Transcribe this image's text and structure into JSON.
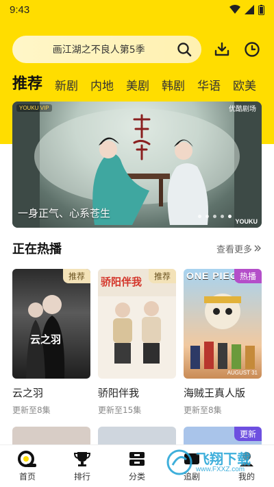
{
  "status": {
    "time": "9:43"
  },
  "search": {
    "query": "画江湖之不良人第5季"
  },
  "tabs": [
    {
      "label": "推荐",
      "active": true
    },
    {
      "label": "新剧"
    },
    {
      "label": "内地"
    },
    {
      "label": "美剧"
    },
    {
      "label": "韩剧"
    },
    {
      "label": "华语"
    },
    {
      "label": "欧美"
    }
  ],
  "banner": {
    "caption": "一身正气、心系苍生",
    "logo_top_left": "YOUKU VIP",
    "logo_top_right": "优酷剧场",
    "logo_bottom_right": "YOUKU",
    "show_title_art": "安乐传",
    "dots_total": 5,
    "dots_active_index": 4
  },
  "section": {
    "title": "正在热播",
    "more": "查看更多"
  },
  "cards": [
    {
      "title": "云之羽",
      "subtitle": "更新至8集",
      "badge": "推荐",
      "poster_text": "云之羽"
    },
    {
      "title": "骄阳伴我",
      "subtitle": "更新至15集",
      "badge": "推荐",
      "poster_text": "骄阳伴我"
    },
    {
      "title": "海贼王真人版",
      "subtitle": "更新至8集",
      "badge": "热播",
      "poster_text": "ONE PIECE",
      "poster_sub": "AUGUST 31"
    }
  ],
  "row2": {
    "badge_third": "更新"
  },
  "nav": [
    {
      "label": "首页"
    },
    {
      "label": "排行"
    },
    {
      "label": "分类"
    },
    {
      "label": "追剧"
    },
    {
      "label": "我的"
    }
  ],
  "watermark": {
    "text": "飞翔下载",
    "url": "www.FXXZ.com"
  },
  "colors": {
    "brand": "#FFDD00",
    "badge_recommend": "#F3E2B8",
    "badge_hot": "#B44EC9"
  }
}
